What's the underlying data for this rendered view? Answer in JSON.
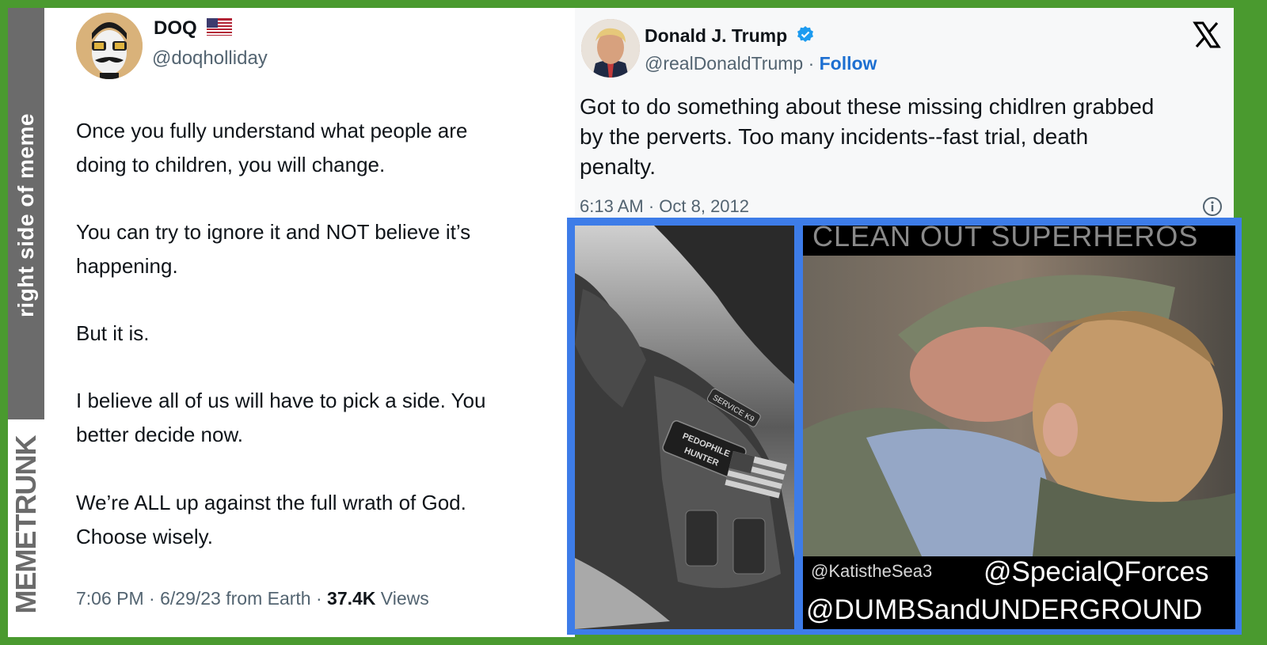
{
  "meme": {
    "side_label": "right side of meme",
    "brand": "MEMETRUNK"
  },
  "doq_tweet": {
    "name": "DOQ",
    "flag_icon": "us-flag-icon",
    "handle": "@doqholliday",
    "paragraphs": [
      [
        "Once you fully understand what people are",
        "doing to children, you will change."
      ],
      [
        "You can try to ignore it and NOT believe it’s",
        "happening."
      ],
      [
        "But it is."
      ],
      [
        "I believe all of us will have to pick a side. You",
        "better decide now."
      ],
      [
        "We’re ALL up against the full wrath of God.",
        "Choose wisely."
      ]
    ],
    "footer": {
      "time": "7:06 PM · 6/29/23 from Earth · ",
      "views_count": "37.4K",
      "views_label": " Views"
    }
  },
  "trump_tweet": {
    "name": "Donald J. Trump",
    "handle": "@realDonaldTrump · ",
    "follow_label": "Follow",
    "text_lines": [
      "Got to do something about these missing chidlren grabbed",
      "by the perverts. Too many incidents--fast trial, death",
      "penalty."
    ],
    "timestamp": "6:13 AM · Oct 8, 2012"
  },
  "meme_image": {
    "title": "CLEAN OUT SUPERHEROS",
    "patch_service": "SERVICE K9",
    "patch_hunter_1": "PEDOPHILE",
    "patch_hunter_2": "HUNTER",
    "credit_small": "@KatistheSea3",
    "credit_main": "@SpecialQForces",
    "credit_bottom": "@DUMBSandUNDERGROUND"
  },
  "colors": {
    "frame_green": "#4a9a2f",
    "frame_blue": "#3d7ce8",
    "follow_blue": "#1d6fd1",
    "verified_blue": "#1d9bf0",
    "strip_gray": "#6b6b6b"
  }
}
